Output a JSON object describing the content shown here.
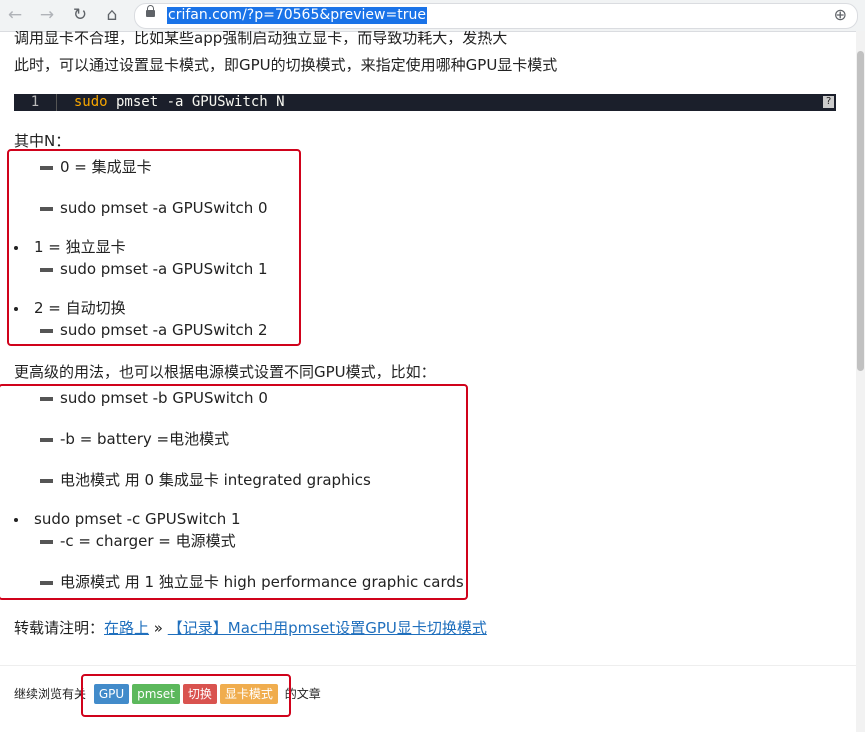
{
  "browser": {
    "url": "crifan.com/?p=70565&preview=true",
    "back_icon": "←",
    "forward_icon": "→",
    "reload_icon": "↻",
    "home_icon": "⌂",
    "addtab_icon": "⊕"
  },
  "article": {
    "cut_line": "调用显卡不合理，比如某些app强制启动独立显卡，而导致功耗大，发热大",
    "intro": "此时，可以通过设置显卡模式，即GPU的切换模式，来指定使用哪种GPU显卡模式",
    "code": {
      "line_no": "1",
      "cmd": "sudo",
      "rest": " pmset -a GPUSwitch N",
      "help": "?"
    },
    "n_label": "其中N：",
    "n_items": {
      "i0a": "0 = 集成显卡",
      "i0b": "sudo pmset -a GPUSwitch 0",
      "i1": "1 = 独立显卡",
      "i1b": "sudo pmset -a GPUSwitch 1",
      "i2": "2 = 自动切换",
      "i2b": "sudo pmset -a GPUSwitch 2"
    },
    "advanced_label": "更高级的用法，也可以根据电源模式设置不同GPU模式，比如：",
    "adv_items": {
      "a1": "sudo pmset -b GPUSwitch 0",
      "a2": "-b = battery =电池模式",
      "a3": "电池模式 用 0 集成显卡 integrated graphics",
      "b1": "sudo pmset -c GPUSwitch 1",
      "b2": "-c = charger = 电源模式",
      "b3": "电源模式 用 1 独立显卡 high performance graphic cards"
    },
    "reprint_prefix": "转载请注明：",
    "reprint_site": "在路上",
    "reprint_sep": " » ",
    "reprint_title": "【记录】Mac中用pmset设置GPU显卡切换模式"
  },
  "tags_section": {
    "prefix": "继续浏览有关",
    "suffix": "的文章",
    "tags": [
      {
        "label": "GPU",
        "color": "#428bca"
      },
      {
        "label": "pmset",
        "color": "#5cb85c"
      },
      {
        "label": "切换",
        "color": "#d9534f"
      },
      {
        "label": "显卡模式",
        "color": "#f0ad4e"
      }
    ]
  }
}
